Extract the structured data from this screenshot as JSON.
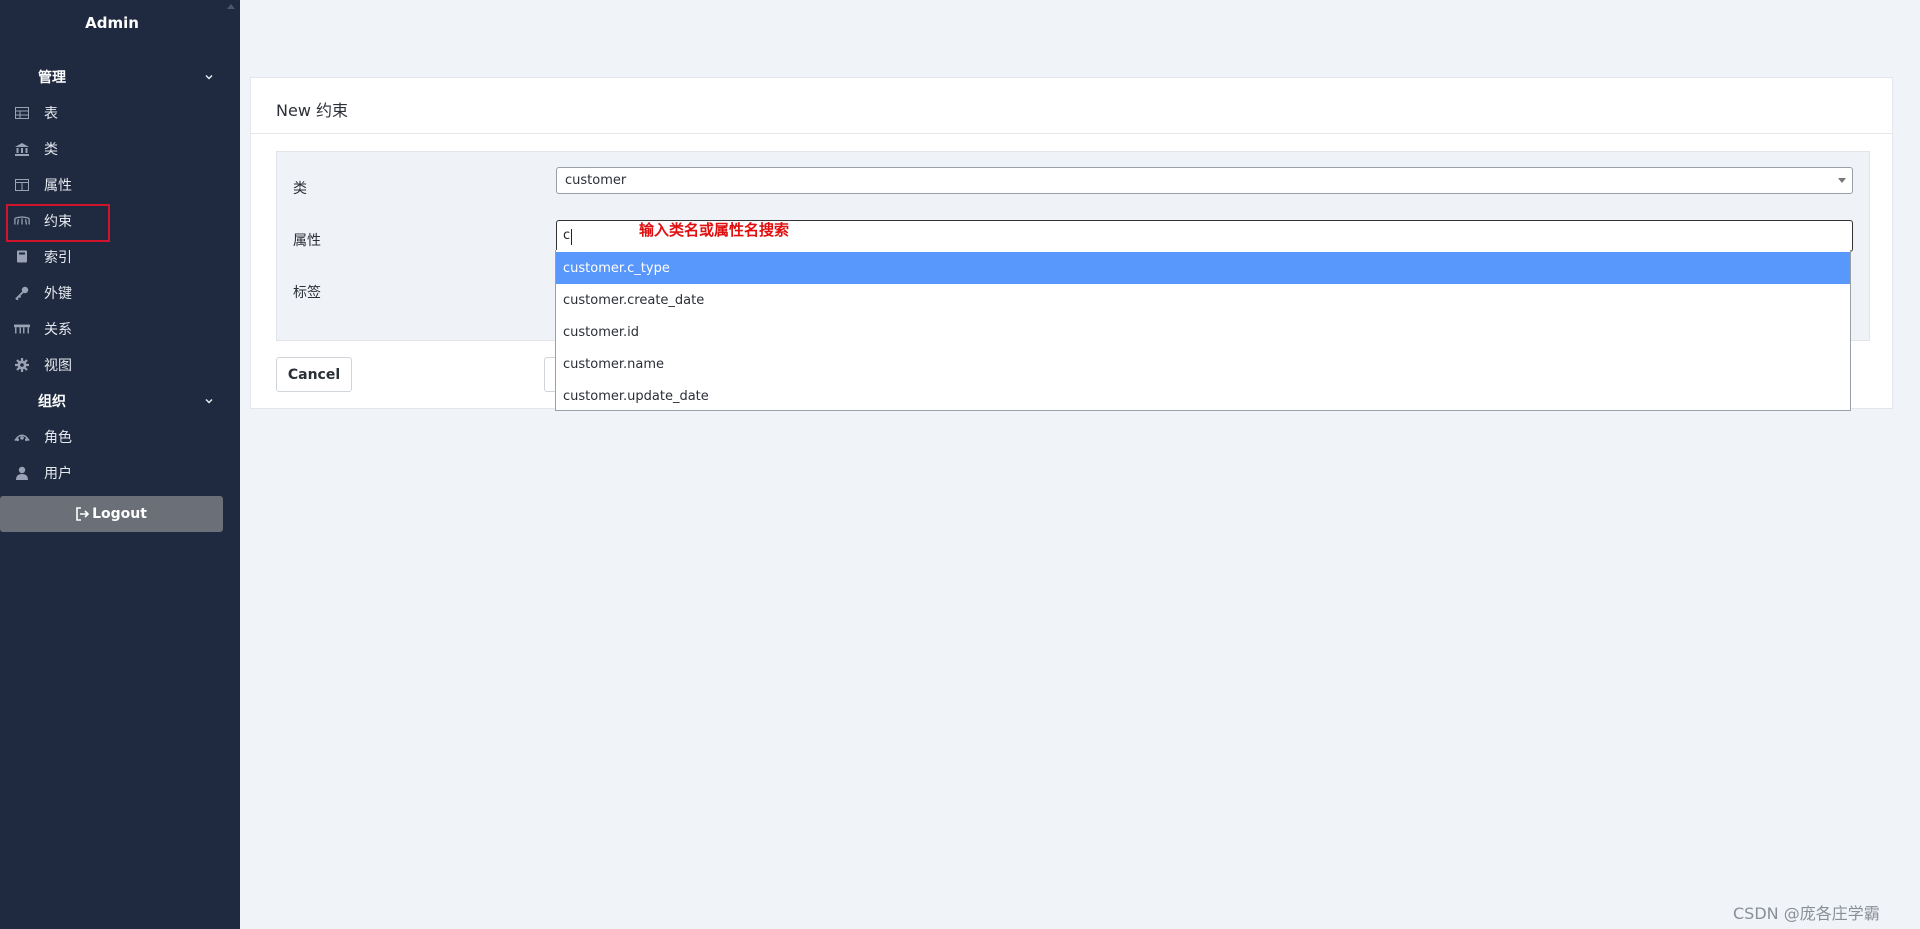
{
  "sidebar": {
    "brand": "Admin",
    "groups": [
      {
        "label": "管理"
      },
      {
        "label": "组织"
      }
    ],
    "items": [
      {
        "label": "表",
        "icon": "table-icon"
      },
      {
        "label": "类",
        "icon": "bank-icon"
      },
      {
        "label": "属性",
        "icon": "columns-icon"
      },
      {
        "label": "约束",
        "icon": "constraint-icon"
      },
      {
        "label": "索引",
        "icon": "book-icon"
      },
      {
        "label": "外键",
        "icon": "key-icon"
      },
      {
        "label": "关系",
        "icon": "relation-icon"
      },
      {
        "label": "视图",
        "icon": "gear-icon"
      },
      {
        "label": "角色",
        "icon": "roles-icon"
      },
      {
        "label": "用户",
        "icon": "user-icon"
      }
    ],
    "logout_label": "Logout"
  },
  "main": {
    "panel_title": "New 约束",
    "form": {
      "class_label": "类",
      "class_value": "customer",
      "attribute_label": "属性",
      "attribute_value": "c",
      "tag_label": "标签"
    },
    "cancel_label": "Cancel",
    "dropdown_options": [
      "customer.c_type",
      "customer.create_date",
      "customer.id",
      "customer.name",
      "customer.update_date"
    ],
    "annotation": "输入类名或属性名搜索"
  },
  "watermark": "CSDN @庞各庄学霸",
  "colors": {
    "sidebar_bg": "#1f2a40",
    "active_option": "#5897fb",
    "annotation": "#e01010",
    "highlight_border": "#d0142c"
  }
}
